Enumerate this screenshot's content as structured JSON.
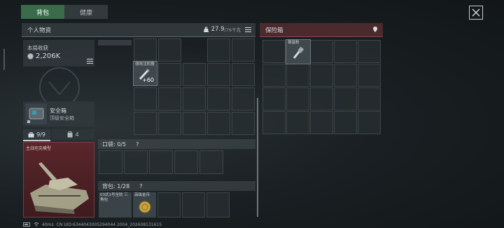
{
  "tabs": [
    {
      "label": "背包",
      "active": true
    },
    {
      "label": "健康",
      "active": false
    }
  ],
  "items_panel": {
    "title": "个人物资",
    "weight": "27.9",
    "weight_total": "/76千克"
  },
  "harvest": {
    "label": "本局收获",
    "value": "2,206K"
  },
  "safebox": {
    "name": "安全箱",
    "desc": "顶级安全箱"
  },
  "stats": {
    "armor": "9/9",
    "bag": "4"
  },
  "model": {
    "caption": "主战坦克模型"
  },
  "grid_item": {
    "name": "强效注射器",
    "count": "60"
  },
  "pockets": {
    "label": "口袋: 0/5",
    "help": "?"
  },
  "backpack": {
    "label": "背包: 1/28",
    "help": "?"
  },
  "backpack_items": [
    {
      "name": "03式1号全防 三角包"
    },
    {
      "name": "高级金币"
    }
  ],
  "safe_panel": {
    "title": "保险箱",
    "key_name": "钢温枪"
  },
  "status": {
    "ping": "40ms",
    "uid": "CN UID:6344043005294044 2004_202608131615"
  },
  "colors": {
    "accent": "#3a6b4a",
    "safe": "#4b2a2e"
  }
}
